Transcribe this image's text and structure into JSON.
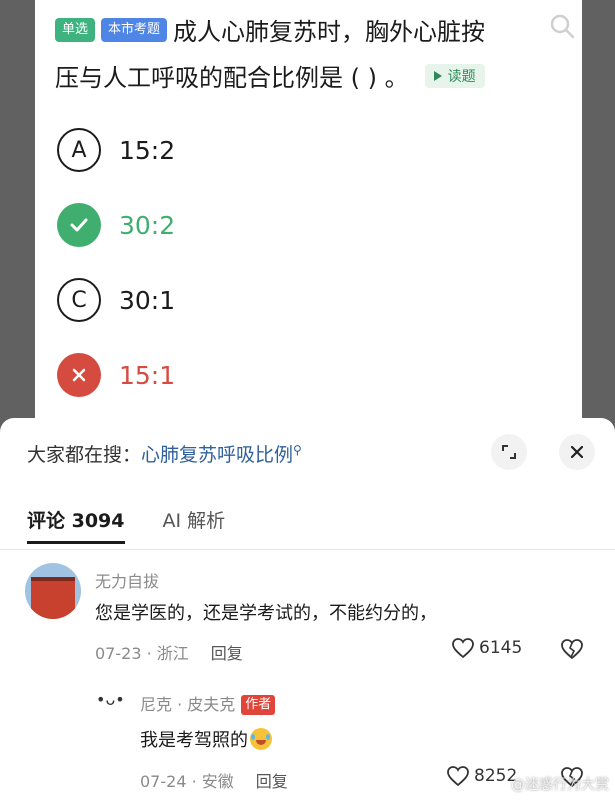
{
  "question": {
    "tag_single": "单选",
    "tag_city": "本市考题",
    "line1": "成人心肺复苏时，胸外心脏按",
    "line2": "压与人工呼吸的配合比例是 ( ) 。",
    "read_label": "读题"
  },
  "options": [
    {
      "letter": "A",
      "text": "15:2",
      "state": "normal"
    },
    {
      "letter": "",
      "text": "30:2",
      "state": "correct"
    },
    {
      "letter": "C",
      "text": "30:1",
      "state": "normal"
    },
    {
      "letter": "",
      "text": "15:1",
      "state": "wrong"
    }
  ],
  "panel": {
    "search_label": "大家都在搜：",
    "search_term": "心肺复苏呼吸比例"
  },
  "tabs": [
    {
      "label": "评论 3094",
      "active": true
    },
    {
      "label": "AI 解析",
      "active": false
    }
  ],
  "comments": [
    {
      "name": "无力自拔",
      "text": "您是学医的，还是学考试的，不能约分的，",
      "date_location": "07-23 · 浙江",
      "reply_label": "回复",
      "likes": "6145"
    }
  ],
  "reply": {
    "avatar_text": "•ᴗ•",
    "name": "尼克 · 皮夫克",
    "author_tag": "作者",
    "text": "我是考驾照的",
    "date_location": "07-24 · 安徽",
    "reply_label": "回复",
    "likes": "8252"
  },
  "watermark": "@迷惑行为大赏",
  "colors": {
    "correct": "#3fae6f",
    "wrong": "#d64b3f",
    "tag_single": "#3fb37f",
    "tag_city": "#4f86e6",
    "search_term": "#2f5f9c",
    "author_tag": "#e0453a"
  }
}
